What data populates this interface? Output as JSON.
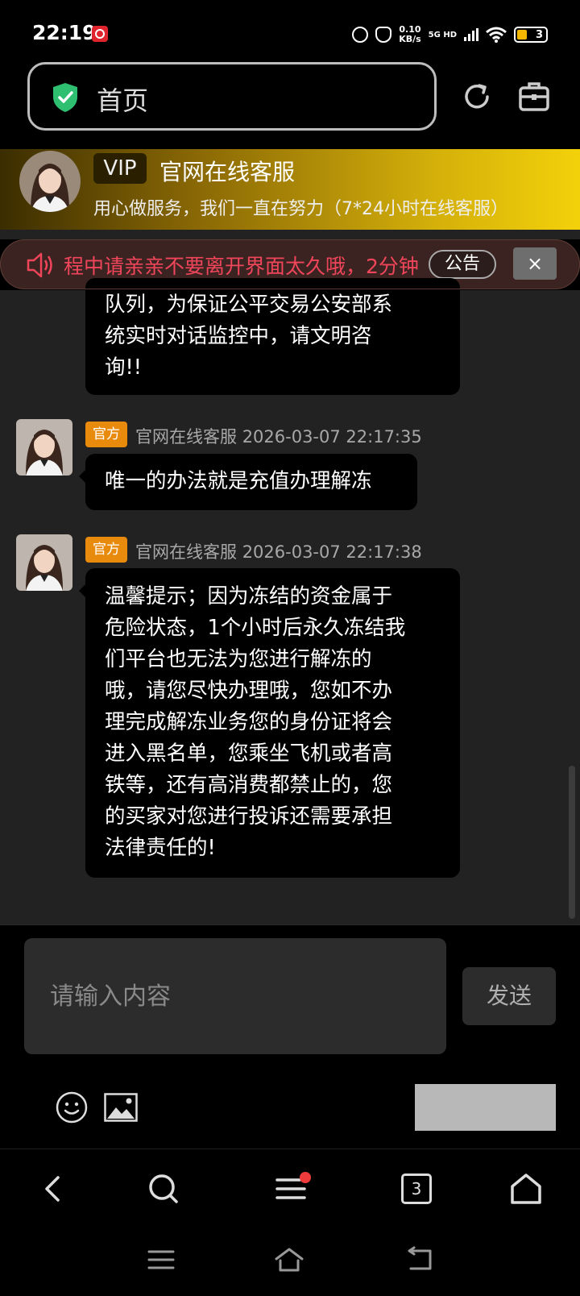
{
  "status_bar": {
    "time": "22:19",
    "net_speed_value": "0.10",
    "net_speed_unit": "KB/s",
    "signal_label": "5G HD",
    "battery": "3",
    "icons": [
      "alarm-icon",
      "mute-icon",
      "signal-icon",
      "wifi-icon",
      "battery-icon"
    ]
  },
  "address_bar": {
    "url_text": "首页",
    "icons": [
      "shield-check-icon",
      "reload-icon",
      "toolbox-icon"
    ]
  },
  "vip_header": {
    "badge": "VIP",
    "title": "官网在线客服",
    "subtitle": "用心做服务，我们一直在努力（7*24小时在线客服）"
  },
  "notice": {
    "text": "程中请亲亲不要离开界面太久哦，2分钟",
    "tag": "公告",
    "close": "×"
  },
  "messages": [
    {
      "text_lines": [
        "队列，为保证公平交易公安部系",
        "统实时对话监控中，请文明咨",
        "询!!"
      ]
    },
    {
      "tag": "官方",
      "sender": "官网在线客服",
      "time": "2026-03-07 22:17:35",
      "text_lines": [
        "唯一的办法就是充值办理解冻"
      ]
    },
    {
      "tag": "官方",
      "sender": "官网在线客服",
      "time": "2026-03-07 22:17:38",
      "text_lines": [
        "温馨提示；因为冻结的资金属于",
        "危险状态，1个小时后永久冻结我",
        "们平台也无法为您进行解冻的",
        "哦，请您尽快办理哦，您如不办",
        "理完成解冻业务您的身份证将会",
        "进入黑名单，您乘坐飞机或者高",
        "铁等，还有高消费都禁止的，您",
        "的买家对您进行投诉还需要承担",
        "法律责任的!"
      ]
    }
  ],
  "composer": {
    "placeholder": "请输入内容",
    "send_label": "发送"
  },
  "browser_nav": {
    "tab_count": "3"
  },
  "colors": {
    "accent_gold": "#f3d10a",
    "notice_text": "#f0455a",
    "tag_orange": "#e88a0c",
    "shield_green": "#2fbf71"
  }
}
